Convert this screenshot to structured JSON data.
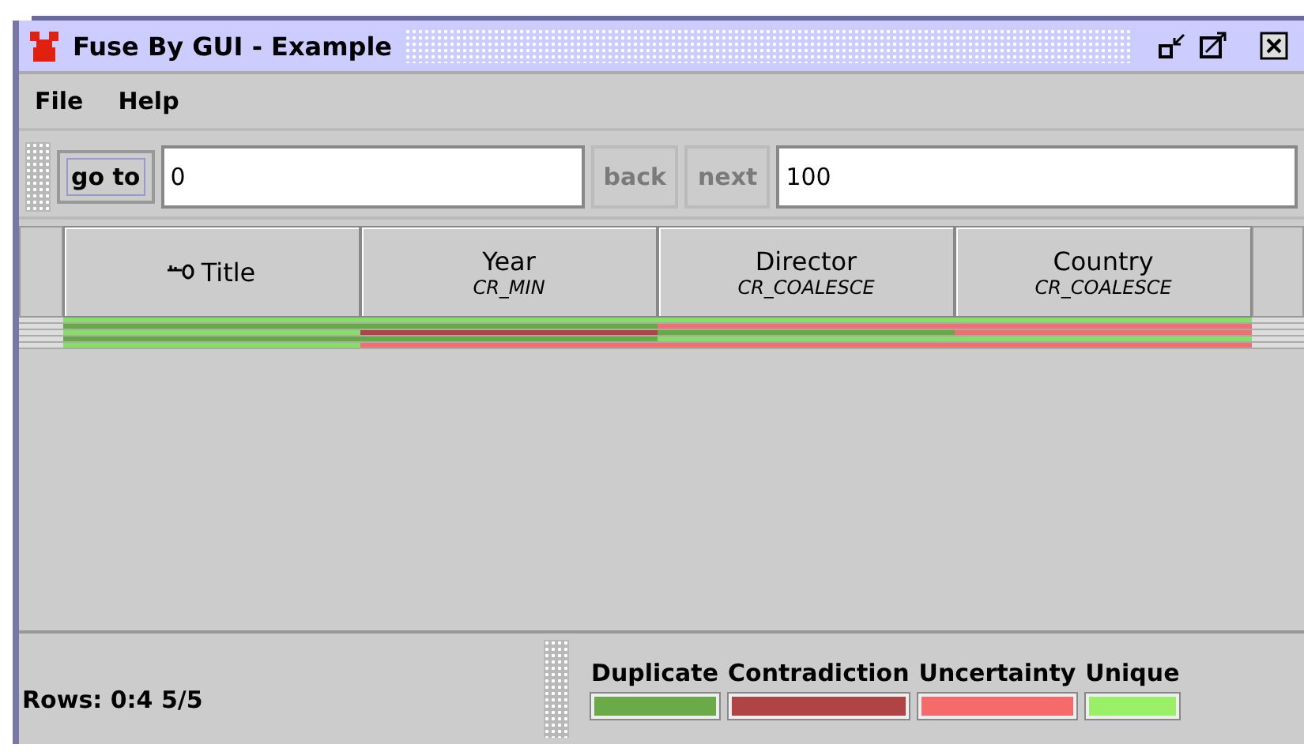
{
  "window": {
    "title": "Fuse By GUI - Example"
  },
  "menu": [
    "File",
    "Help"
  ],
  "toolbar": {
    "goto_label": "go to",
    "from_value": "0",
    "back_label": "back",
    "back_disabled": true,
    "next_label": "next",
    "next_disabled": true,
    "to_value": "100"
  },
  "table": {
    "columns": [
      {
        "name": "Title",
        "key": true
      },
      {
        "name": "Year",
        "function": "CR_MIN",
        "key": false
      },
      {
        "name": "Director",
        "function": "CR_COALESCE",
        "key": false
      },
      {
        "name": "Country",
        "function": "CR_COALESCE",
        "key": false
      }
    ],
    "rows": [
      {
        "cells": [
          {
            "color": "#88dd66"
          },
          {
            "color": "#88dd66"
          },
          {
            "color": "#88dd66"
          },
          {
            "color": "#88dd66"
          }
        ]
      },
      {
        "cells": [
          {
            "color": "#66aa44"
          },
          {
            "color": "#66aa44"
          },
          {
            "color": "#ee7070"
          },
          {
            "color": "#ee7070"
          }
        ]
      },
      {
        "cells": [
          {
            "color": "#88dd66"
          },
          {
            "color": "#b04444"
          },
          {
            "color": "#66aa44"
          },
          {
            "color": "#ee7070"
          }
        ]
      },
      {
        "cells": [
          {
            "color": "#66aa44"
          },
          {
            "color": "#66aa44"
          },
          {
            "color": "#88dd66"
          },
          {
            "color": "#88dd66"
          }
        ]
      },
      {
        "cells": [
          {
            "color": "#88dd66"
          },
          {
            "color": "#ee7070"
          },
          {
            "color": "#ee7070"
          },
          {
            "color": "#ee7070"
          }
        ]
      }
    ]
  },
  "status": {
    "rows": "Rows: 0:4 5/5"
  },
  "legend": [
    {
      "label": "Duplicate",
      "color": "#6aaa48"
    },
    {
      "label": "Contradiction",
      "color": "#b04444"
    },
    {
      "label": "Uncertainty",
      "color": "#f56a6a"
    },
    {
      "label": "Unique",
      "color": "#99f066"
    }
  ]
}
